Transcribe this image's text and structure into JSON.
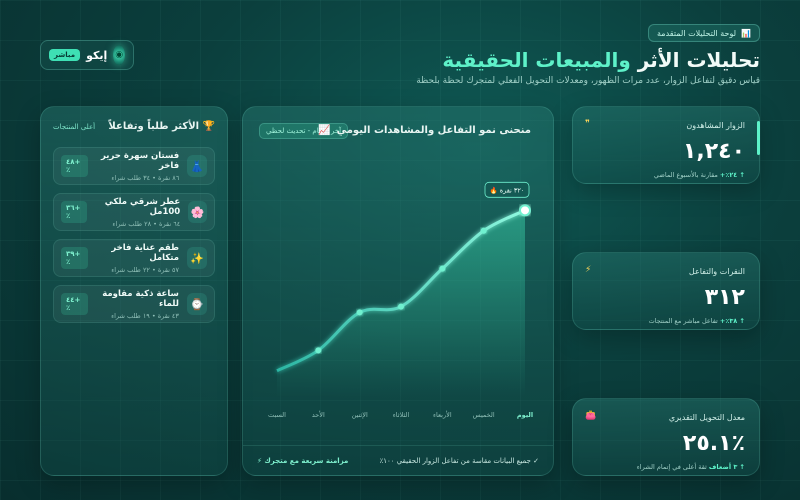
{
  "header": {
    "badge": "لوحة التحليلات المتقدمة",
    "title_main": "تحليلات الأثر ",
    "title_accent": "والمبيعات الحقيقية",
    "subtitle": "قياس دقيق لتفاعل الزوار، عدد مرات الظهور، ومعدلات التحويل الفعلي لمتجرك لحظة بلحظة",
    "live_label": "مباشر",
    "brand_name": "إيكو"
  },
  "products": {
    "title": "الأكثر طلباً وتفاعلاً",
    "link": "أعلى المنتجات",
    "items": [
      {
        "name": "فستان سهرة حرير فاخر",
        "sub": "٨٦ نقرة • ٣٤ طلب شراء",
        "pct": "٤٨+٪",
        "icon": "👗"
      },
      {
        "name": "عطر شرقي ملكي 100مل",
        "sub": "٦٤ نقرة • ٢٨ طلب شراء",
        "pct": "٣٦+٪",
        "icon": "🌸"
      },
      {
        "name": "طقم عناية فاخر متكامل",
        "sub": "٥٧ نقرة • ٢٢ طلب شراء",
        "pct": "٣٩+٪",
        "icon": "✨"
      },
      {
        "name": "ساعة ذكية مقاومة للماء",
        "sub": "٤٣ نقرة • ١٩ طلب شراء",
        "pct": "٤٤+٪",
        "icon": "⌚"
      }
    ]
  },
  "chart": {
    "title": "منحنى نمو التفاعل والمشاهدات اليومي",
    "range_label": "آخر ٧ أيام - تحديث لحظي",
    "peak_label": "٣٢٠ نقرة",
    "footer_left": "مزامنة سريعة مع متجرك",
    "footer_right": "جميع البيانات مقاسة من تفاعل الزوار الحقيقي ١٠٠٪"
  },
  "chart_data": {
    "type": "area",
    "categories": [
      "السبت",
      "الأحد",
      "الإثنين",
      "الثلاثاء",
      "الأربعاء",
      "الخميس",
      "اليوم"
    ],
    "values": [
      45,
      80,
      145,
      155,
      220,
      285,
      320
    ],
    "ylim": [
      0,
      360
    ]
  },
  "metrics": [
    {
      "label": "الزوار المشاهدون",
      "value": "١,٢٤٠",
      "note_up": "↑ ٢٤٪+",
      "note": "مقارنة بالأسبوع الماضي",
      "icon": "❞"
    },
    {
      "label": "النقرات والتفاعل",
      "value": "٣١٢",
      "note_up": "↑ ٣٨٪+",
      "note": "تفاعل مباشر مع المنتجات",
      "icon": "⚡"
    },
    {
      "label": "معدل التحويل التقديري",
      "value": "٢٥.١٪",
      "note_up": "↑ ٣ أضعاف",
      "note": "ثقة أعلى في إتمام الشراء",
      "icon": "👛"
    }
  ],
  "colors": {
    "accent": "#5ef2c9",
    "bg": "#0b3f3d"
  }
}
